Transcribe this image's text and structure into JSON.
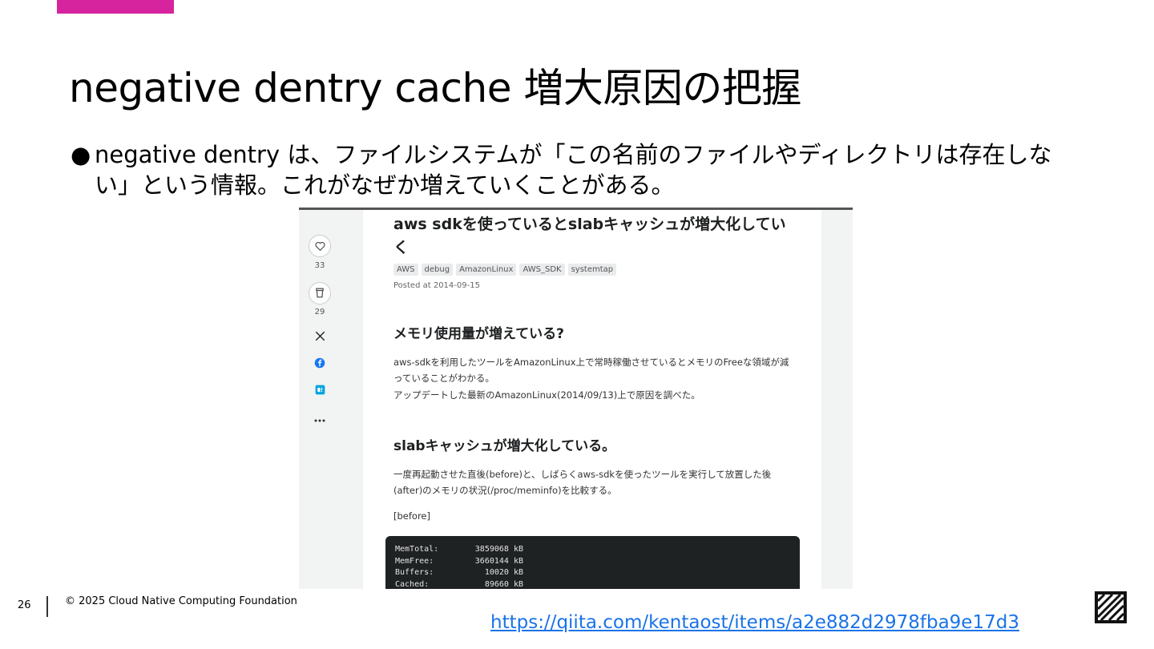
{
  "slide": {
    "title": "negative dentry cache  増大原因の把握",
    "bullet_marker": "●",
    "bullet_text": "negative dentry  は、ファイルシステムが「この名前のファイルやディレクトリは存在しない」という情報。これがなぜか増えていくことがある。",
    "accent_color": "#d6249f"
  },
  "screenshot": {
    "sidebar": {
      "like_count": "33",
      "stock_count": "29",
      "icons": [
        "heart-icon",
        "stock-icon",
        "x-icon",
        "facebook-icon",
        "hatena-icon",
        "more-icon"
      ]
    },
    "article": {
      "title": "aws sdkを使っているとslabキャッシュが増大化していく",
      "tags": [
        "AWS",
        "debug",
        "AmazonLinux",
        "AWS_SDK",
        "systemtap"
      ],
      "posted": "Posted at 2014-09-15",
      "section1_heading": "メモリ使用量が増えている?",
      "section1_p1": "aws-sdkを利用したツールをAmazonLinux上で常時稼働させているとメモリのFreeな領域が減っていることがわかる。",
      "section1_p2": "アップデートした最新のAmazonLinux(2014/09/13)上で原因を調べた。",
      "section2_heading": "slabキャッシュが増大化している。",
      "section2_p1": "一度再起動させた直後(before)と、しばらくaws-sdkを使ったツールを実行して放置した後(after)のメモリの状況(/proc/meminfo)を比較する。",
      "before_label": "[before]",
      "code_rows": [
        {
          "key": "MemTotal:",
          "val": "3859068 kB"
        },
        {
          "key": "MemFree:",
          "val": "3660144 kB"
        },
        {
          "key": "Buffers:",
          "val": "10020 kB"
        },
        {
          "key": "Cached:",
          "val": "89660 kB"
        }
      ]
    }
  },
  "footer": {
    "page_number": "26",
    "copyright": "© 2025 Cloud Native Computing Foundation",
    "link": "https://qiita.com/kentaost/items/a2e882d2978fba9e17d3"
  }
}
